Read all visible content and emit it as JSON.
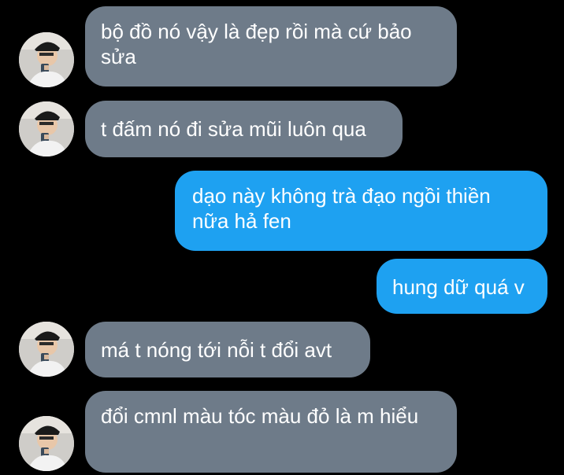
{
  "conversation": {
    "messages": [
      {
        "sender": "other",
        "text": "bộ đồ nó vậy là đẹp rồi mà cứ bảo sửa"
      },
      {
        "sender": "other",
        "text": "t đấm nó đi sửa mũi luôn qua"
      },
      {
        "sender": "me",
        "text": "dạo này không trà đạo ngồi thiền nữa hả fen"
      },
      {
        "sender": "me",
        "text": "hung dữ quá v"
      },
      {
        "sender": "other",
        "text": "má t nóng tới nỗi t đổi avt"
      },
      {
        "sender": "other",
        "text": "đổi cmnl màu tóc màu đỏ là m hiểu"
      }
    ]
  },
  "colors": {
    "background": "#000000",
    "incoming_bubble": "#6e7b89",
    "outgoing_bubble": "#1ea1f1",
    "text": "#ffffff"
  },
  "icons": {
    "avatar": "contact-avatar-photo"
  }
}
